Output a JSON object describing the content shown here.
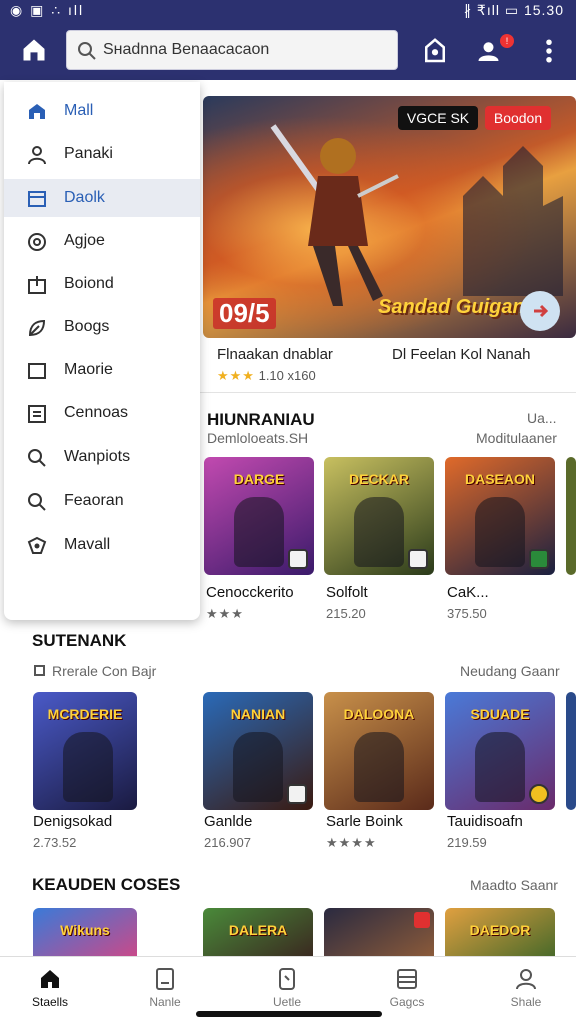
{
  "status": {
    "left": "◉ ▣ ∴ ıll",
    "right": "∦ ₹ıll ▭ 15.30"
  },
  "search": {
    "value": "Sнаdnna Веnаасасаon"
  },
  "drawer": {
    "items": [
      {
        "label": "Mall",
        "icon": "store-icon"
      },
      {
        "label": "Panaki",
        "icon": "person-icon"
      },
      {
        "label": "Daolk",
        "icon": "bookmark-card-icon"
      },
      {
        "label": "Agjoe",
        "icon": "target-icon"
      },
      {
        "label": "Boiond",
        "icon": "share-box-icon"
      },
      {
        "label": "Boogs",
        "icon": "leaf-icon"
      },
      {
        "label": "Maorie",
        "icon": "square-icon"
      },
      {
        "label": "Cennoas",
        "icon": "list-icon"
      },
      {
        "label": "Wanpiots",
        "icon": "search-icon"
      },
      {
        "label": "Feaoran",
        "icon": "search-icon"
      },
      {
        "label": "Mavall",
        "icon": "shield-icon"
      }
    ]
  },
  "hero": {
    "badge_left": "VGCE SK",
    "badge_right": "Boodon",
    "rank": "09/5",
    "logo": "Sandad Guiganw",
    "caption_left": "Flnaakan dnablar",
    "caption_right": "Dl Feelan Kol Nanah",
    "rating": "1.10 x160"
  },
  "section1": {
    "title": "HIUNRANIAU",
    "subtitle": "Demloloeats.SH",
    "more_top": "Ua...",
    "more": "Moditulaaner",
    "items": [
      {
        "tile_title": "DARGE",
        "name": "Cenocckerito",
        "meta": "★★★",
        "color": "#7a3aa8"
      },
      {
        "tile_title": "DECKAR",
        "name": "Solfolt",
        "meta": "215.20",
        "color": "#4c6a2a"
      },
      {
        "tile_title": "DASEAON",
        "name": "CaK...",
        "meta": "375.50",
        "color": "#a83a1a"
      }
    ]
  },
  "section2": {
    "title": "SUTENANK",
    "subtitle": "Rrerale Con Bajr",
    "more": "Neudang Gaanr",
    "items": [
      {
        "tile_title": "MCRDERIE",
        "name": "Denigsokad",
        "meta": "2.73.52",
        "color": "#3a3a9a"
      },
      {
        "tile_title": "NANIAN",
        "name": "Ganlde",
        "meta": "216.907",
        "color": "#6a2a20"
      },
      {
        "tile_title": "DALOONA",
        "name": "Sarle Boink",
        "meta": "★★★★",
        "color": "#8a4a2a"
      },
      {
        "tile_title": "SDUADE",
        "name": "Tauidisoafn",
        "meta": "219.59",
        "color": "#2a4aa8"
      }
    ]
  },
  "section3": {
    "title": "KEAUDEN COSES",
    "more": "Maadto Saanr",
    "items": [
      {
        "tile_title": "Wikuns",
        "color": "#3a6ac8"
      },
      {
        "tile_title": "DALERA",
        "color": "#3a2a20"
      },
      {
        "tile_title": "",
        "color": "#2a2a40"
      },
      {
        "tile_title": "DAEDOR",
        "color": "#a85a1a"
      }
    ]
  },
  "bottomnav": [
    {
      "label": "Staells",
      "icon": "home-icon"
    },
    {
      "label": "Nanle",
      "icon": "tablet-icon"
    },
    {
      "label": "Uetle",
      "icon": "phone-tag-icon"
    },
    {
      "label": "Gagcs",
      "icon": "menu-lines-icon"
    },
    {
      "label": "Shale",
      "icon": "user-icon"
    }
  ]
}
